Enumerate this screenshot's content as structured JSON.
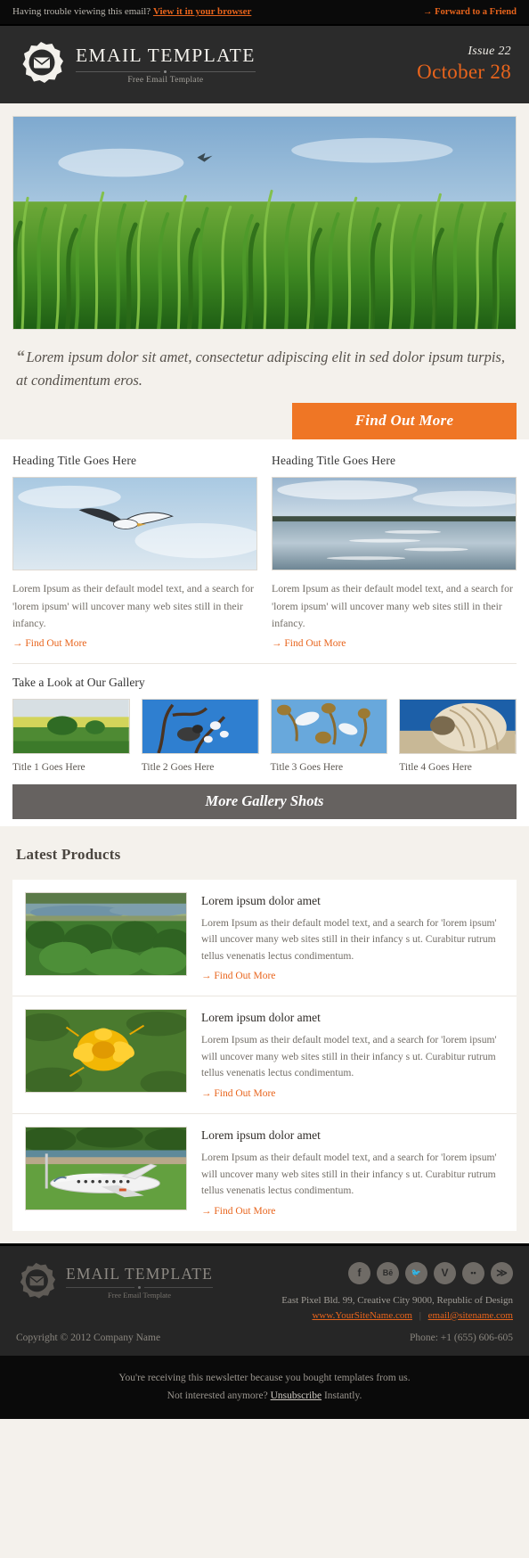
{
  "preheader": {
    "trouble_text": "Having trouble viewing this email?",
    "browser_link": "View it in your browser",
    "forward_link": "→ Forward to a Friend"
  },
  "header": {
    "brand_title": "EMAIL TEMPLATE",
    "brand_subtitle": "Free Email Template",
    "issue_label": "Issue 22",
    "issue_date": "October 28",
    "logo_icon": "envelope-badge-icon"
  },
  "hero": {
    "quote": "Lorem ipsum dolor sit amet, consectetur adipiscing elit in sed dolor ipsum turpis, at condimentum eros.",
    "quote_mark": "“",
    "cta_label": "Find Out More"
  },
  "columns": [
    {
      "heading": "Heading Title Goes Here",
      "text": "Lorem Ipsum as their default model text, and a search for 'lorem ipsum' will uncover many web sites still in their infancy.",
      "link": "→ Find Out More"
    },
    {
      "heading": "Heading Title Goes Here",
      "text": "Lorem Ipsum as their default model text, and a search for 'lorem ipsum' will uncover many web sites still in their infancy.",
      "link": "→ Find Out More"
    }
  ],
  "gallery": {
    "heading": "Take a Look at Our Gallery",
    "items": [
      {
        "title": "Title 1 Goes Here"
      },
      {
        "title": "Title 2 Goes Here"
      },
      {
        "title": "Title 3 Goes Here"
      },
      {
        "title": "Title 4 Goes Here"
      }
    ],
    "button_label": "More Gallery Shots"
  },
  "products_section": {
    "title": "Latest Products",
    "items": [
      {
        "title": "Lorem ipsum dolor amet",
        "text": "Lorem Ipsum as their default model text, and a search for 'lorem ipsum' will uncover many web sites still in their infancy s ut. Curabitur rutrum tellus venenatis lectus condimentum.",
        "link": "→ Find Out More"
      },
      {
        "title": "Lorem ipsum dolor amet",
        "text": "Lorem Ipsum as their default model text, and a search for 'lorem ipsum' will uncover many web sites still in their infancy s ut. Curabitur rutrum tellus venenatis lectus condimentum.",
        "link": "→ Find Out More"
      },
      {
        "title": "Lorem ipsum dolor amet",
        "text": "Lorem Ipsum as their default model text, and a search for 'lorem ipsum' will uncover many web sites still in their infancy s ut. Curabitur rutrum tellus venenatis lectus condimentum.",
        "link": "→ Find Out More"
      }
    ]
  },
  "footer": {
    "brand_title": "EMAIL TEMPLATE",
    "brand_subtitle": "Free Email Template",
    "socials": [
      {
        "name": "facebook",
        "glyph": "f"
      },
      {
        "name": "behance",
        "glyph": "Bē"
      },
      {
        "name": "twitter",
        "glyph": "🐦"
      },
      {
        "name": "vimeo",
        "glyph": "V"
      },
      {
        "name": "flickr",
        "glyph": "••"
      },
      {
        "name": "rss",
        "glyph": "≫"
      }
    ],
    "address": "East Pixel Bld. 99, Creative City 9000, Republic of Design",
    "website": "www.YourSiteName.com",
    "email": "email@sitename.com",
    "copyright": "Copyright © 2012 Company Name",
    "phone": "Phone: +1 (655) 606-605"
  },
  "subfooter": {
    "line1": "You're receiving this newsletter because you bought templates from us.",
    "line2_pre": "Not interested anymore? ",
    "line2_link": "Unsubscribe",
    "line2_post": " Instantly."
  },
  "colors": {
    "accent": "#e8641c",
    "button_orange": "#ef7625",
    "button_gray": "#666260",
    "dark": "#2b2b2b",
    "cream": "#f4f1ec"
  }
}
